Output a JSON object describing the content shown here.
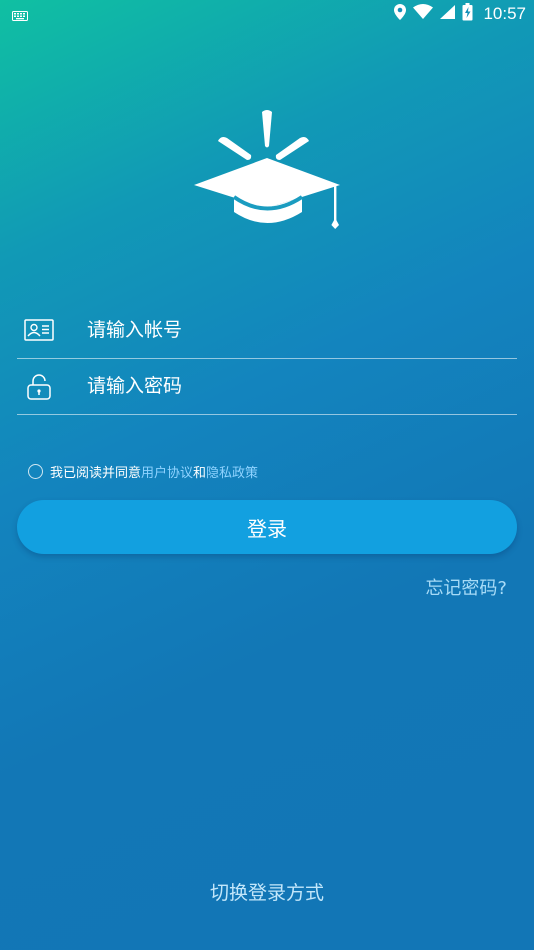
{
  "status_bar": {
    "time": "10:57",
    "icons": [
      "keyboard-icon",
      "location-icon",
      "wifi-icon",
      "signal-icon",
      "battery-icon"
    ]
  },
  "logo": {
    "icon": "graduation-cap-icon"
  },
  "login_form": {
    "account_placeholder": "请输入帐号",
    "password_placeholder": "请输入密码",
    "account_icon": "id-card-icon",
    "password_icon": "lock-icon"
  },
  "agreement": {
    "prefix": "我已阅读并同意",
    "user_agreement": "用户协议",
    "conjunction": "和",
    "privacy_policy": "隐私政策"
  },
  "login_button": "登录",
  "forgot_password": "忘记密码?",
  "switch_login": "切换登录方式",
  "colors": {
    "gradient_top": "#10c0a2",
    "gradient_bottom": "#1276b6",
    "button": "#12a0e0",
    "link": "#8fd3ff"
  }
}
